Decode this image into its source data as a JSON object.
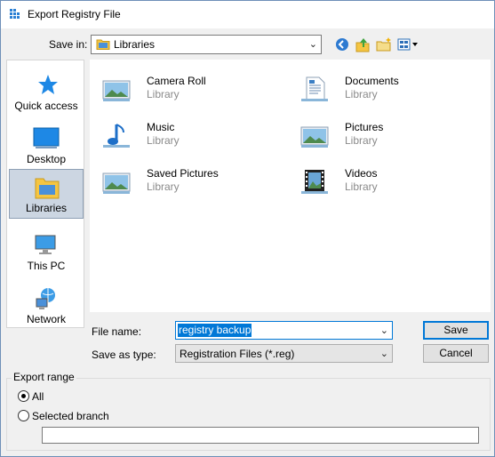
{
  "window": {
    "title": "Export Registry File"
  },
  "toolbar": {
    "save_in_label": "Save in:",
    "save_in_value": "Libraries",
    "icons": [
      "back-icon",
      "up-folder-icon",
      "new-folder-icon",
      "view-menu-icon"
    ]
  },
  "places": [
    {
      "label": "Quick access",
      "icon": "star-icon"
    },
    {
      "label": "Desktop",
      "icon": "desktop-icon"
    },
    {
      "label": "Libraries",
      "icon": "libraries-icon",
      "selected": true
    },
    {
      "label": "This PC",
      "icon": "pc-icon"
    },
    {
      "label": "Network",
      "icon": "network-icon"
    }
  ],
  "libraries": [
    {
      "name": "Camera Roll",
      "type": "Library",
      "icon": "picture-library-icon"
    },
    {
      "name": "Documents",
      "type": "Library",
      "icon": "documents-library-icon"
    },
    {
      "name": "Music",
      "type": "Library",
      "icon": "music-library-icon"
    },
    {
      "name": "Pictures",
      "type": "Library",
      "icon": "picture-library-icon"
    },
    {
      "name": "Saved Pictures",
      "type": "Library",
      "icon": "picture-library-icon"
    },
    {
      "name": "Videos",
      "type": "Library",
      "icon": "videos-library-icon"
    }
  ],
  "form": {
    "file_name_label": "File name:",
    "file_name_value": "registry backup",
    "save_as_type_label": "Save as type:",
    "save_as_type_value": "Registration Files (*.reg)",
    "save_button": "Save",
    "cancel_button": "Cancel"
  },
  "export_range": {
    "title": "Export range",
    "all_label": "All",
    "branch_label": "Selected branch",
    "selected": "All",
    "branch_value": ""
  },
  "colors": {
    "accent": "#0078d7",
    "selection": "#ccd6e2"
  }
}
